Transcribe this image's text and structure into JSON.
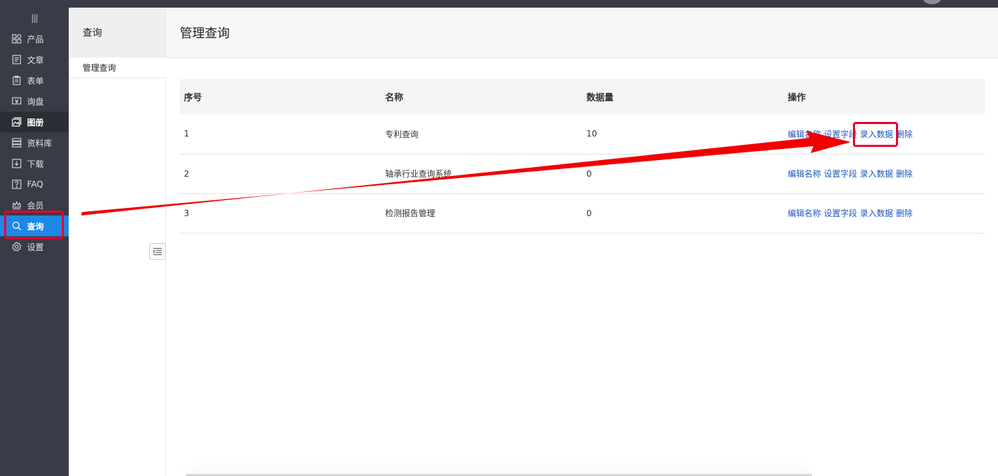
{
  "sidebar": {
    "toggle_icon": "menu-toggle-icon",
    "items": [
      {
        "label": "产品",
        "icon": "grid-icon"
      },
      {
        "label": "文章",
        "icon": "article-icon"
      },
      {
        "label": "表单",
        "icon": "clipboard-icon"
      },
      {
        "label": "询盘",
        "icon": "inquiry-icon"
      },
      {
        "label": "图册",
        "icon": "gallery-icon"
      },
      {
        "label": "资料库",
        "icon": "database-icon"
      },
      {
        "label": "下载",
        "icon": "download-icon"
      },
      {
        "label": "FAQ",
        "icon": "faq-icon"
      },
      {
        "label": "会员",
        "icon": "crown-icon"
      },
      {
        "label": "查询",
        "icon": "search-icon"
      },
      {
        "label": "设置",
        "icon": "gear-icon"
      }
    ]
  },
  "subpanel": {
    "title": "查询",
    "items": [
      {
        "label": "管理查询"
      }
    ]
  },
  "main": {
    "title": "管理查询",
    "table": {
      "headers": [
        "序号",
        "名称",
        "数据量",
        "操作"
      ],
      "rows": [
        {
          "index": "1",
          "name": "专利查询",
          "count": "10"
        },
        {
          "index": "2",
          "name": "轴承行业查询系统",
          "count": "0"
        },
        {
          "index": "3",
          "name": "检测报告管理",
          "count": "0"
        }
      ],
      "actions": {
        "edit_name": "编辑名称",
        "set_fields": "设置字段",
        "enter_data": "录入数据",
        "delete": "删除"
      }
    }
  },
  "colors": {
    "sidebar_bg": "#393c46",
    "active": "#1e88e5",
    "link": "#1a56c4",
    "annotation": "#e8002a"
  }
}
